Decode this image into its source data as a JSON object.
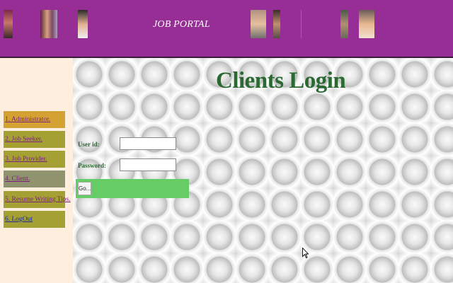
{
  "header": {
    "title": "JOB PORTAL",
    "background": "#962e96"
  },
  "sidebar": {
    "background": "#fdeedd",
    "items": [
      {
        "label": "1. Administrator.",
        "bg": "#d3a232"
      },
      {
        "label": "2. Job Seeker.",
        "bg": "#a4a034"
      },
      {
        "label": "3. Job Provider.",
        "bg": "#a4a034"
      },
      {
        "label": "4. Client.",
        "bg": "#8f946e"
      },
      {
        "label": "5. Resume Writing Tips.",
        "bg": "#a4a034"
      },
      {
        "label": "6. LogOut",
        "bg": "#a4a034"
      }
    ]
  },
  "login": {
    "title": "Clients Login",
    "user_id_label": "User id:",
    "user_id_value": "",
    "password_label": "Password:",
    "password_value": "",
    "go_label": "Go..."
  }
}
